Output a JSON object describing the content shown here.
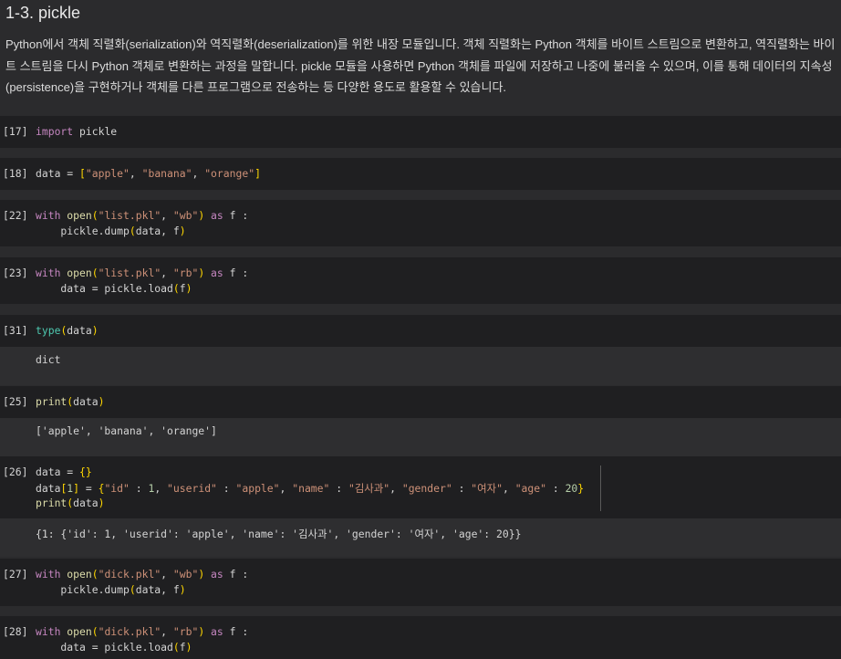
{
  "markdown": {
    "title": "1-3. pickle",
    "paragraph": "Python에서 객체 직렬화(serialization)와 역직렬화(deserialization)를 위한 내장 모듈입니다. 객체 직렬화는 Python 객체를 바이트 스트림으로 변환하고, 역직렬화는 바이트 스트림을 다시 Python 객체로 변환하는 과정을 말합니다. pickle 모듈을 사용하면 Python 객체를 파일에 저장하고 나중에 불러올 수 있으며, 이를 통해 데이터의 지속성(persistence)을 구현하거나 객체를 다른 프로그램으로 전송하는 등 다양한 용도로 활용할 수 있습니다."
  },
  "cells": [
    {
      "prompt": "[17]",
      "lines": [
        [
          [
            "kw",
            "import"
          ],
          [
            "txt",
            " pickle"
          ]
        ]
      ]
    },
    {
      "prompt": "[18]",
      "lines": [
        [
          [
            "txt",
            "data = "
          ],
          [
            "br1",
            "["
          ],
          [
            "str",
            "\"apple\""
          ],
          [
            "txt",
            ", "
          ],
          [
            "str",
            "\"banana\""
          ],
          [
            "txt",
            ", "
          ],
          [
            "str",
            "\"orange\""
          ],
          [
            "br1",
            "]"
          ]
        ]
      ]
    },
    {
      "prompt": "[22]",
      "lines": [
        [
          [
            "kw",
            "with"
          ],
          [
            "txt",
            " "
          ],
          [
            "fn",
            "open"
          ],
          [
            "br1",
            "("
          ],
          [
            "str",
            "\"list.pkl\""
          ],
          [
            "txt",
            ", "
          ],
          [
            "str",
            "\"wb\""
          ],
          [
            "br1",
            ")"
          ],
          [
            "txt",
            " "
          ],
          [
            "kw",
            "as"
          ],
          [
            "txt",
            " f :"
          ]
        ],
        [
          [
            "txt",
            "    pickle.dump"
          ],
          [
            "br1",
            "("
          ],
          [
            "txt",
            "data, f"
          ],
          [
            "br1",
            ")"
          ]
        ]
      ]
    },
    {
      "prompt": "[23]",
      "lines": [
        [
          [
            "kw",
            "with"
          ],
          [
            "txt",
            " "
          ],
          [
            "fn",
            "open"
          ],
          [
            "br1",
            "("
          ],
          [
            "str",
            "\"list.pkl\""
          ],
          [
            "txt",
            ", "
          ],
          [
            "str",
            "\"rb\""
          ],
          [
            "br1",
            ")"
          ],
          [
            "txt",
            " "
          ],
          [
            "kw",
            "as"
          ],
          [
            "txt",
            " f :"
          ]
        ],
        [
          [
            "txt",
            "    data = pickle.load"
          ],
          [
            "br1",
            "("
          ],
          [
            "txt",
            "f"
          ],
          [
            "br1",
            ")"
          ]
        ]
      ]
    },
    {
      "prompt": "[31]",
      "lines": [
        [
          [
            "bfn",
            "type"
          ],
          [
            "br1",
            "("
          ],
          [
            "txt",
            "data"
          ],
          [
            "br1",
            ")"
          ]
        ]
      ],
      "output": [
        "dict"
      ]
    },
    {
      "prompt": "[25]",
      "lines": [
        [
          [
            "fn",
            "print"
          ],
          [
            "br1",
            "("
          ],
          [
            "txt",
            "data"
          ],
          [
            "br1",
            ")"
          ]
        ]
      ],
      "output": [
        "['apple', 'banana', 'orange']"
      ]
    },
    {
      "prompt": "[26]",
      "lines": [
        [
          [
            "txt",
            "data = "
          ],
          [
            "br1",
            "{}"
          ]
        ],
        [
          [
            "txt",
            "data"
          ],
          [
            "br1",
            "["
          ],
          [
            "num",
            "1"
          ],
          [
            "br1",
            "]"
          ],
          [
            "txt",
            " = "
          ],
          [
            "br1",
            "{"
          ],
          [
            "str",
            "\"id\""
          ],
          [
            "txt",
            " : "
          ],
          [
            "num",
            "1"
          ],
          [
            "txt",
            ", "
          ],
          [
            "str",
            "\"userid\""
          ],
          [
            "txt",
            " : "
          ],
          [
            "str",
            "\"apple\""
          ],
          [
            "txt",
            ", "
          ],
          [
            "str",
            "\"name\""
          ],
          [
            "txt",
            " : "
          ],
          [
            "str",
            "\"김사과\""
          ],
          [
            "txt",
            ", "
          ],
          [
            "str",
            "\"gender\""
          ],
          [
            "txt",
            " : "
          ],
          [
            "str",
            "\"여자\""
          ],
          [
            "txt",
            ", "
          ],
          [
            "str",
            "\"age\""
          ],
          [
            "txt",
            " : "
          ],
          [
            "num",
            "20"
          ],
          [
            "br1",
            "}"
          ]
        ],
        [
          [
            "fn",
            "print"
          ],
          [
            "br1",
            "("
          ],
          [
            "txt",
            "data"
          ],
          [
            "br1",
            ")"
          ]
        ]
      ],
      "output": [
        "{1: {'id': 1, 'userid': 'apple', 'name': '김사과', 'gender': '여자', 'age': 20}}"
      ]
    },
    {
      "prompt": "[27]",
      "lines": [
        [
          [
            "kw",
            "with"
          ],
          [
            "txt",
            " "
          ],
          [
            "fn",
            "open"
          ],
          [
            "br1",
            "("
          ],
          [
            "str",
            "\"dick.pkl\""
          ],
          [
            "txt",
            ", "
          ],
          [
            "str",
            "\"wb\""
          ],
          [
            "br1",
            ")"
          ],
          [
            "txt",
            " "
          ],
          [
            "kw",
            "as"
          ],
          [
            "txt",
            " f :"
          ]
        ],
        [
          [
            "txt",
            "    pickle.dump"
          ],
          [
            "br1",
            "("
          ],
          [
            "txt",
            "data, f"
          ],
          [
            "br1",
            ")"
          ]
        ]
      ]
    },
    {
      "prompt": "[28]",
      "lines": [
        [
          [
            "kw",
            "with"
          ],
          [
            "txt",
            " "
          ],
          [
            "fn",
            "open"
          ],
          [
            "br1",
            "("
          ],
          [
            "str",
            "\"dick.pkl\""
          ],
          [
            "txt",
            ", "
          ],
          [
            "str",
            "\"rb\""
          ],
          [
            "br1",
            ")"
          ],
          [
            "txt",
            " "
          ],
          [
            "kw",
            "as"
          ],
          [
            "txt",
            " f :"
          ]
        ],
        [
          [
            "txt",
            "    data = pickle.load"
          ],
          [
            "br1",
            "("
          ],
          [
            "txt",
            "f"
          ],
          [
            "br1",
            ")"
          ]
        ]
      ]
    }
  ]
}
